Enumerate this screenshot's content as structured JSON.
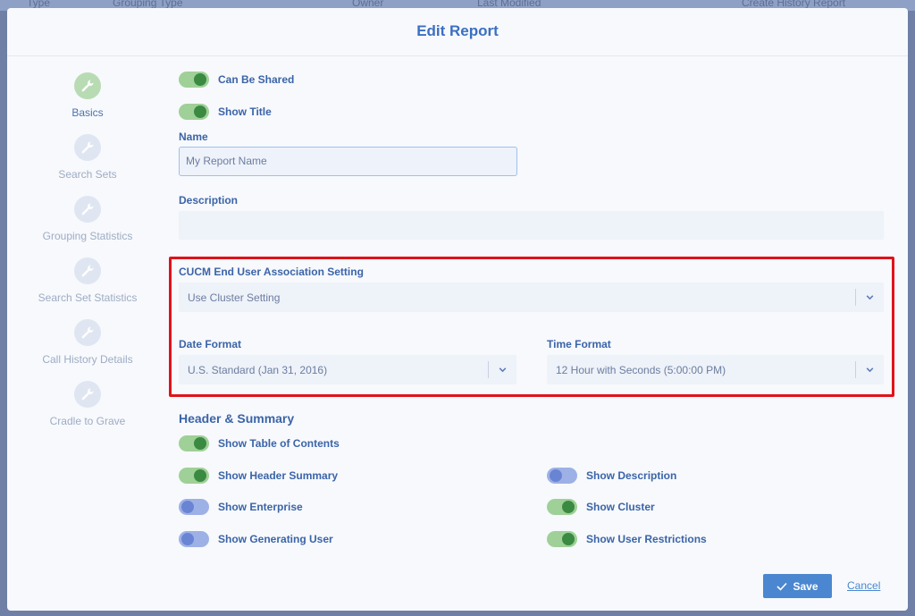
{
  "background": {
    "columns": [
      "Type",
      "Grouping Type",
      "Owner",
      "Last Modified",
      "Create History Report"
    ]
  },
  "modal": {
    "title": "Edit Report"
  },
  "sidebar": {
    "items": [
      {
        "label": "Basics",
        "icon": "wrench-icon",
        "active": true
      },
      {
        "label": "Search Sets",
        "icon": "wrench-icon",
        "active": false
      },
      {
        "label": "Grouping Statistics",
        "icon": "wrench-icon",
        "active": false
      },
      {
        "label": "Search Set Statistics",
        "icon": "wrench-icon",
        "active": false
      },
      {
        "label": "Call History Details",
        "icon": "wrench-icon",
        "active": false
      },
      {
        "label": "Cradle to Grave",
        "icon": "wrench-icon",
        "active": false
      }
    ]
  },
  "basics": {
    "can_be_shared": {
      "label": "Can Be Shared",
      "on": true
    },
    "show_title": {
      "label": "Show Title",
      "on": true
    },
    "name_label": "Name",
    "name_value": "My Report Name",
    "description_label": "Description",
    "description_value": ""
  },
  "settings": {
    "cucm_label": "CUCM End User Association Setting",
    "cucm_value": "Use Cluster Setting",
    "date_format_label": "Date Format",
    "date_format_value": "U.S. Standard (Jan 31, 2016)",
    "time_format_label": "Time Format",
    "time_format_value": "12 Hour with Seconds (5:00:00 PM)"
  },
  "header_summary": {
    "heading": "Header & Summary",
    "toggles": [
      {
        "label": "Show Table of Contents",
        "on": true
      },
      {
        "label": "Show Header Summary",
        "on": true
      },
      {
        "label": "Show Description",
        "on": false
      },
      {
        "label": "Show Enterprise",
        "on": false
      },
      {
        "label": "Show Cluster",
        "on": true
      },
      {
        "label": "Show Generating User",
        "on": false
      },
      {
        "label": "Show User Restrictions",
        "on": true
      }
    ]
  },
  "footer": {
    "save_label": "Save",
    "cancel_label": "Cancel"
  },
  "colors": {
    "accent": "#3b6fc1",
    "toggle_on": "#3a8a42",
    "toggle_off": "#6a84d4",
    "highlight": "#e0121a",
    "save_button": "#4b87d0"
  }
}
